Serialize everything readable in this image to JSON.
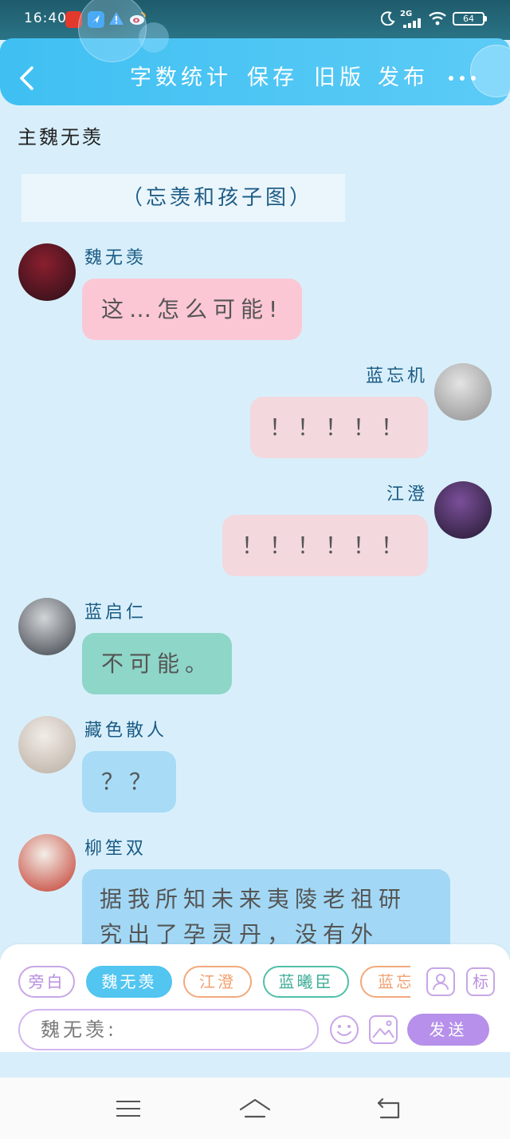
{
  "status_bar": {
    "time": "16:40",
    "network_type": "2G",
    "battery_level": "64",
    "notification_icons": [
      "shop-app-icon",
      "navigation-app-icon",
      "warning-icon",
      "weibo-icon"
    ],
    "system_icons": [
      "moon-icon",
      "signal-icon",
      "wifi-icon",
      "battery-icon"
    ]
  },
  "header": {
    "back_icon": "chevron-left-icon",
    "actions": [
      "字数统计",
      "保存",
      "旧版",
      "发布"
    ],
    "more_icon": "more-icon",
    "color": "#47c6f4"
  },
  "story": {
    "protagonist_label": "主魏无羡",
    "narration": "（忘羡和孩子图）"
  },
  "messages": [
    {
      "speaker": "魏无羡",
      "text": "这…怎么可能!",
      "bubble_color": "#fcc7d4",
      "avatar_colors": [
        "#8a1f2e",
        "#2a0f18"
      ]
    },
    {
      "speaker": "蓝忘机",
      "text": "！！！！！",
      "bubble_color": "#f3d8de",
      "avatar_colors": [
        "#e4e4e4",
        "#8e8e8e"
      ]
    },
    {
      "speaker": "江澄",
      "text": "！！！！！！",
      "bubble_color": "#f3d8de",
      "avatar_colors": [
        "#7b4f9a",
        "#22182e"
      ]
    },
    {
      "speaker": "蓝启仁",
      "text": "不可能。",
      "bubble_color": "#8ed6c8",
      "avatar_colors": [
        "#d2d5d8",
        "#3a3f46"
      ]
    },
    {
      "speaker": "藏色散人",
      "text": "？？",
      "bubble_color": "#a7dbf6",
      "avatar_colors": [
        "#f2ede8",
        "#b8aca0"
      ]
    },
    {
      "speaker": "柳笙双",
      "text": "据我所知未来夷陵老祖研究出了孕灵丹，没有外",
      "bubble_color": "#a2d8f5",
      "avatar_colors": [
        "#f3eee8",
        "#c2382a"
      ]
    }
  ],
  "composer": {
    "characters": [
      {
        "name": "旁白",
        "color": "#c7a6e6",
        "text_color": "#b98fe0",
        "active": false
      },
      {
        "name": "魏无羡",
        "color": "#52c5f0",
        "text_color": "#ffffff",
        "active": true
      },
      {
        "name": "江澄",
        "color": "#f2a97c",
        "text_color": "#f0a070",
        "active": false
      },
      {
        "name": "蓝曦臣",
        "color": "#4fbfa8",
        "text_color": "#3fae97",
        "active": false
      },
      {
        "name": "蓝忘",
        "color": "#f2a97c",
        "text_color": "#f0a070",
        "active": false
      }
    ],
    "contact_icon": "person-card-icon",
    "tag_label": "标",
    "input_placeholder": "魏无羡:",
    "emoji_icon": "smiley-icon",
    "image_icon": "image-icon",
    "send_label": "发送",
    "accent_color": "#b690ea"
  },
  "nav_bar": {
    "icons": [
      "menu-icon",
      "home-icon",
      "back-icon"
    ]
  },
  "theme": {
    "background": "#d8effb",
    "name_color": "#1b5b84",
    "narration_color": "#1e5d86"
  }
}
